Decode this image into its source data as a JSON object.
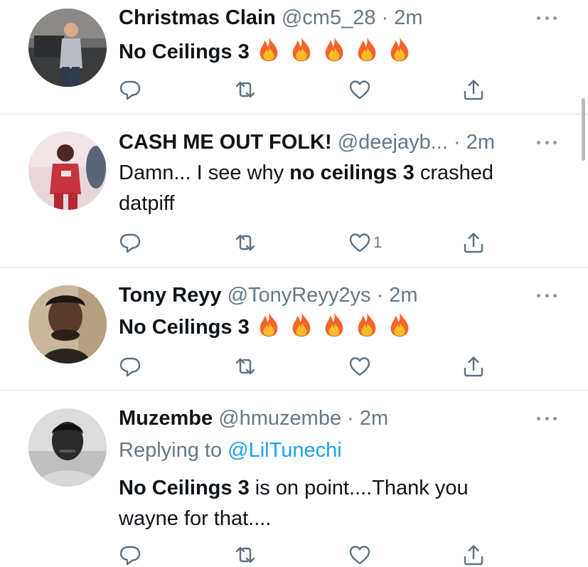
{
  "tweets": [
    {
      "name": "Christmas Clain",
      "handle": "@cm5_28",
      "separator": "·",
      "time": "2m",
      "text_bold": "No Ceilings 3",
      "emoji_count": 5,
      "like_count": ""
    },
    {
      "name": "CASH ME OUT FOLK!",
      "handle": "@deejayb...",
      "separator": "·",
      "time": "2m",
      "text_plain_before": "Damn... I see why ",
      "text_bold": "no ceilings 3",
      "text_plain_after": " crashed datpiff",
      "like_count": "1"
    },
    {
      "name": "Tony Reyy",
      "handle": "@TonyReyy2ys",
      "separator": "·",
      "time": "2m",
      "text_bold": "No Ceilings 3",
      "emoji_count": 5,
      "like_count": ""
    },
    {
      "name": "Muzembe",
      "handle": "@hmuzembe",
      "separator": "·",
      "time": "2m",
      "replying_prefix": "Replying to ",
      "replying_mention": "@LilTunechi",
      "text_bold": "No Ceilings 3",
      "text_plain_after": " is on point....Thank you wayne for that....",
      "like_count": ""
    }
  ],
  "icons": {
    "reply": "reply-icon",
    "retweet": "retweet-icon",
    "like": "like-icon",
    "share": "share-icon",
    "more": "more-icon",
    "emoji": "fire-emoji"
  },
  "colors": {
    "primary_text": "#0f1419",
    "secondary_text": "#657786",
    "link": "#1da1f2",
    "divider": "#d9dde1",
    "icon": "#5b7083"
  }
}
